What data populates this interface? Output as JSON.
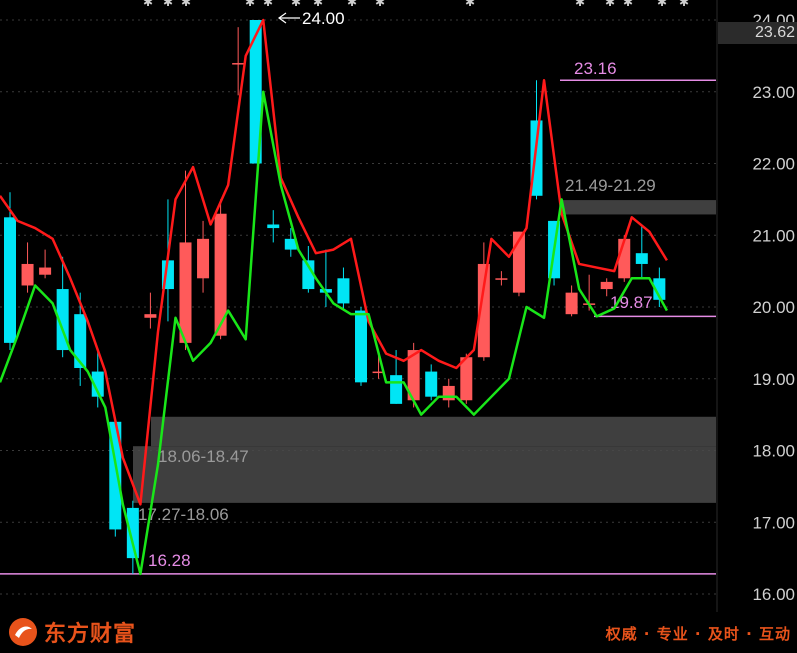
{
  "chart_data": {
    "type": "candlestick",
    "y_axis": {
      "ticks": [
        "24.00",
        "23.00",
        "22.00",
        "21.00",
        "20.00",
        "19.00",
        "18.00",
        "17.00",
        "16.00"
      ],
      "min": 15.8,
      "max": 24.05,
      "current_price": "23.62"
    },
    "candles": [
      {
        "o": 21.25,
        "c": 19.5,
        "h": 21.6,
        "l": 19.4
      },
      {
        "o": 20.3,
        "c": 20.6,
        "h": 20.9,
        "l": 20.2
      },
      {
        "o": 20.45,
        "c": 20.55,
        "h": 20.8,
        "l": 20.4
      },
      {
        "o": 20.25,
        "c": 19.4,
        "h": 20.7,
        "l": 19.3
      },
      {
        "o": 19.9,
        "c": 19.15,
        "h": 20.2,
        "l": 18.9
      },
      {
        "o": 19.1,
        "c": 18.75,
        "h": 19.4,
        "l": 18.6
      },
      {
        "o": 18.4,
        "c": 16.9,
        "h": 18.4,
        "l": 16.8
      },
      {
        "o": 17.2,
        "c": 16.5,
        "h": 17.3,
        "l": 16.28
      },
      {
        "o": 19.85,
        "c": 19.9,
        "h": 20.2,
        "l": 19.7
      },
      {
        "o": 20.65,
        "c": 20.25,
        "h": 21.5,
        "l": 19.8
      },
      {
        "o": 19.5,
        "c": 20.9,
        "h": 21.9,
        "l": 19.4
      },
      {
        "o": 20.4,
        "c": 20.95,
        "h": 21.2,
        "l": 20.2
      },
      {
        "o": 19.6,
        "c": 21.3,
        "h": 21.5,
        "l": 19.55
      },
      {
        "o": 23.4,
        "c": 23.4,
        "h": 23.9,
        "l": 22.95
      },
      {
        "o": 24.0,
        "c": 22.0,
        "h": 24.0,
        "l": 22.0
      },
      {
        "o": 21.15,
        "c": 21.1,
        "h": 21.35,
        "l": 20.9
      },
      {
        "o": 20.95,
        "c": 20.8,
        "h": 21.1,
        "l": 20.7
      },
      {
        "o": 20.65,
        "c": 20.25,
        "h": 20.85,
        "l": 20.2
      },
      {
        "o": 20.25,
        "c": 20.2,
        "h": 20.8,
        "l": 20.0
      },
      {
        "o": 20.4,
        "c": 20.05,
        "h": 20.55,
        "l": 19.95
      },
      {
        "o": 19.95,
        "c": 18.95,
        "h": 20.0,
        "l": 18.9
      },
      {
        "o": 19.1,
        "c": 19.1,
        "h": 19.35,
        "l": 19.0
      },
      {
        "o": 19.05,
        "c": 18.65,
        "h": 19.4,
        "l": 18.65
      },
      {
        "o": 18.7,
        "c": 19.4,
        "h": 19.5,
        "l": 18.6
      },
      {
        "o": 19.1,
        "c": 18.75,
        "h": 19.2,
        "l": 18.7
      },
      {
        "o": 18.7,
        "c": 18.9,
        "h": 19.0,
        "l": 18.6
      },
      {
        "o": 18.7,
        "c": 19.3,
        "h": 19.35,
        "l": 18.65
      },
      {
        "o": 19.3,
        "c": 20.6,
        "h": 20.9,
        "l": 19.25
      },
      {
        "o": 20.4,
        "c": 20.4,
        "h": 20.5,
        "l": 20.3
      },
      {
        "o": 20.2,
        "c": 21.05,
        "h": 21.05,
        "l": 20.15
      },
      {
        "o": 22.6,
        "c": 21.55,
        "h": 23.16,
        "l": 21.5
      },
      {
        "o": 21.2,
        "c": 20.4,
        "h": 21.2,
        "l": 20.3
      },
      {
        "o": 19.9,
        "c": 20.2,
        "h": 20.3,
        "l": 19.87
      },
      {
        "o": 20.05,
        "c": 20.05,
        "h": 20.45,
        "l": 19.95
      },
      {
        "o": 20.25,
        "c": 20.35,
        "h": 20.4,
        "l": 20.15
      },
      {
        "o": 20.4,
        "c": 20.95,
        "h": 21.0,
        "l": 20.35
      },
      {
        "o": 20.75,
        "c": 20.6,
        "h": 21.15,
        "l": 20.4
      },
      {
        "o": 20.4,
        "c": 20.1,
        "h": 20.55,
        "l": 20.0
      }
    ],
    "upper_band": [
      21.55,
      21.2,
      21.1,
      20.95,
      20.4,
      19.8,
      19.1,
      17.9,
      17.25,
      19.65,
      21.5,
      21.95,
      21.15,
      21.7,
      23.5,
      24.0,
      21.8,
      21.25,
      20.75,
      20.8,
      20.95,
      19.8,
      19.35,
      19.25,
      19.4,
      19.25,
      19.15,
      19.4,
      20.95,
      20.7,
      21.1,
      23.16,
      21.3,
      20.6,
      20.55,
      20.5,
      21.25,
      21.05,
      20.65
    ],
    "lower_band": [
      18.95,
      19.6,
      20.3,
      20.05,
      19.4,
      19.1,
      18.6,
      17.25,
      16.28,
      17.8,
      19.85,
      19.25,
      19.5,
      19.95,
      19.55,
      23.0,
      21.7,
      20.8,
      20.4,
      20.05,
      19.9,
      19.9,
      18.95,
      18.95,
      18.5,
      18.75,
      18.75,
      18.5,
      18.75,
      19.0,
      20.0,
      19.85,
      21.5,
      20.25,
      19.87,
      19.98,
      20.4,
      20.4,
      19.95
    ],
    "resistance_lines": [
      {
        "price": 23.16,
        "label": "23.16"
      },
      {
        "price": 19.87,
        "label": "19.87"
      },
      {
        "price": 16.28,
        "label": "16.28"
      }
    ],
    "zones": [
      {
        "low": 21.29,
        "high": 21.49,
        "label": "21.49-21.29"
      },
      {
        "low": 18.06,
        "high": 18.47,
        "label": "18.06-18.47"
      },
      {
        "low": 17.27,
        "high": 18.06,
        "label": "17.27-18.06"
      }
    ],
    "peak_label": "24.00",
    "colors": {
      "up": "#ff5a5a",
      "down": "#00e5f5",
      "upper_line": "#ff1a1a",
      "lower_line": "#19e619",
      "level_line": "#e58ce5",
      "zone": "#4a4a4a",
      "grid": "#3a3a3a"
    }
  },
  "footer": {
    "brand_name": "东方财富",
    "slogan": "权威 · 专业 · 及时 · 互动"
  }
}
